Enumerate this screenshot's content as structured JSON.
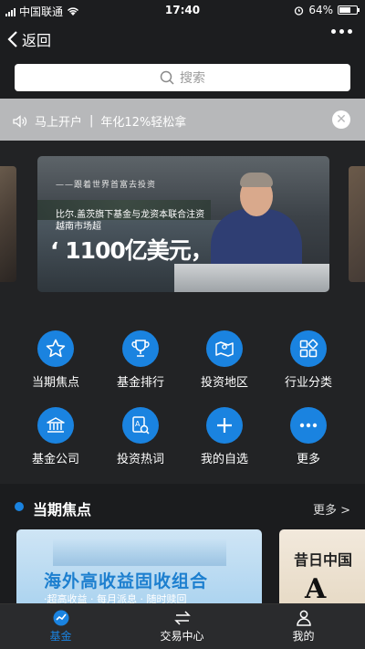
{
  "status_bar": {
    "carrier": "中国联通",
    "time": "17:40",
    "battery": "64%",
    "battery_level": 0.64
  },
  "nav": {
    "back_label": "返回",
    "more_icon": "more-dots-icon"
  },
  "search": {
    "placeholder": "搜索",
    "icon": "search-icon"
  },
  "notice": {
    "text_left": "马上开户",
    "separator": "|",
    "text_right": "年化12%轻松拿",
    "icon": "speaker-icon",
    "close_icon": "close-icon"
  },
  "banner": {
    "subtitle": "——跟着世界首富去投资",
    "headline": "比尔.盖茨旗下基金与龙资本联合注资越南市场超",
    "big_text": "‘ 1100亿美元，"
  },
  "grid": {
    "items": [
      {
        "label": "当期焦点",
        "icon": "star-icon"
      },
      {
        "label": "基金排行",
        "icon": "trophy-icon"
      },
      {
        "label": "投资地区",
        "icon": "map-icon"
      },
      {
        "label": "行业分类",
        "icon": "category-icon"
      },
      {
        "label": "基金公司",
        "icon": "bank-icon"
      },
      {
        "label": "投资热词",
        "icon": "search-doc-icon"
      },
      {
        "label": "我的自选",
        "icon": "plus-icon"
      },
      {
        "label": "更多",
        "icon": "more-icon"
      }
    ]
  },
  "section": {
    "title": "当期焦点",
    "more_label": "更多 >"
  },
  "cards": [
    {
      "title": "海外高收益固收组合",
      "subtitle": "·超高收益 · 每月派息 · 随时赎回"
    },
    {
      "title": "昔日中国",
      "big": "A"
    }
  ],
  "tab_bar": {
    "tabs": [
      {
        "label": "基金",
        "icon": "fund-icon",
        "active": true
      },
      {
        "label": "交易中心",
        "icon": "exchange-icon",
        "active": false
      },
      {
        "label": "我的",
        "icon": "user-icon",
        "active": false
      }
    ]
  },
  "colors": {
    "accent": "#1a83e0",
    "background": "#222325",
    "notice_bg": "#b7b8ba"
  }
}
